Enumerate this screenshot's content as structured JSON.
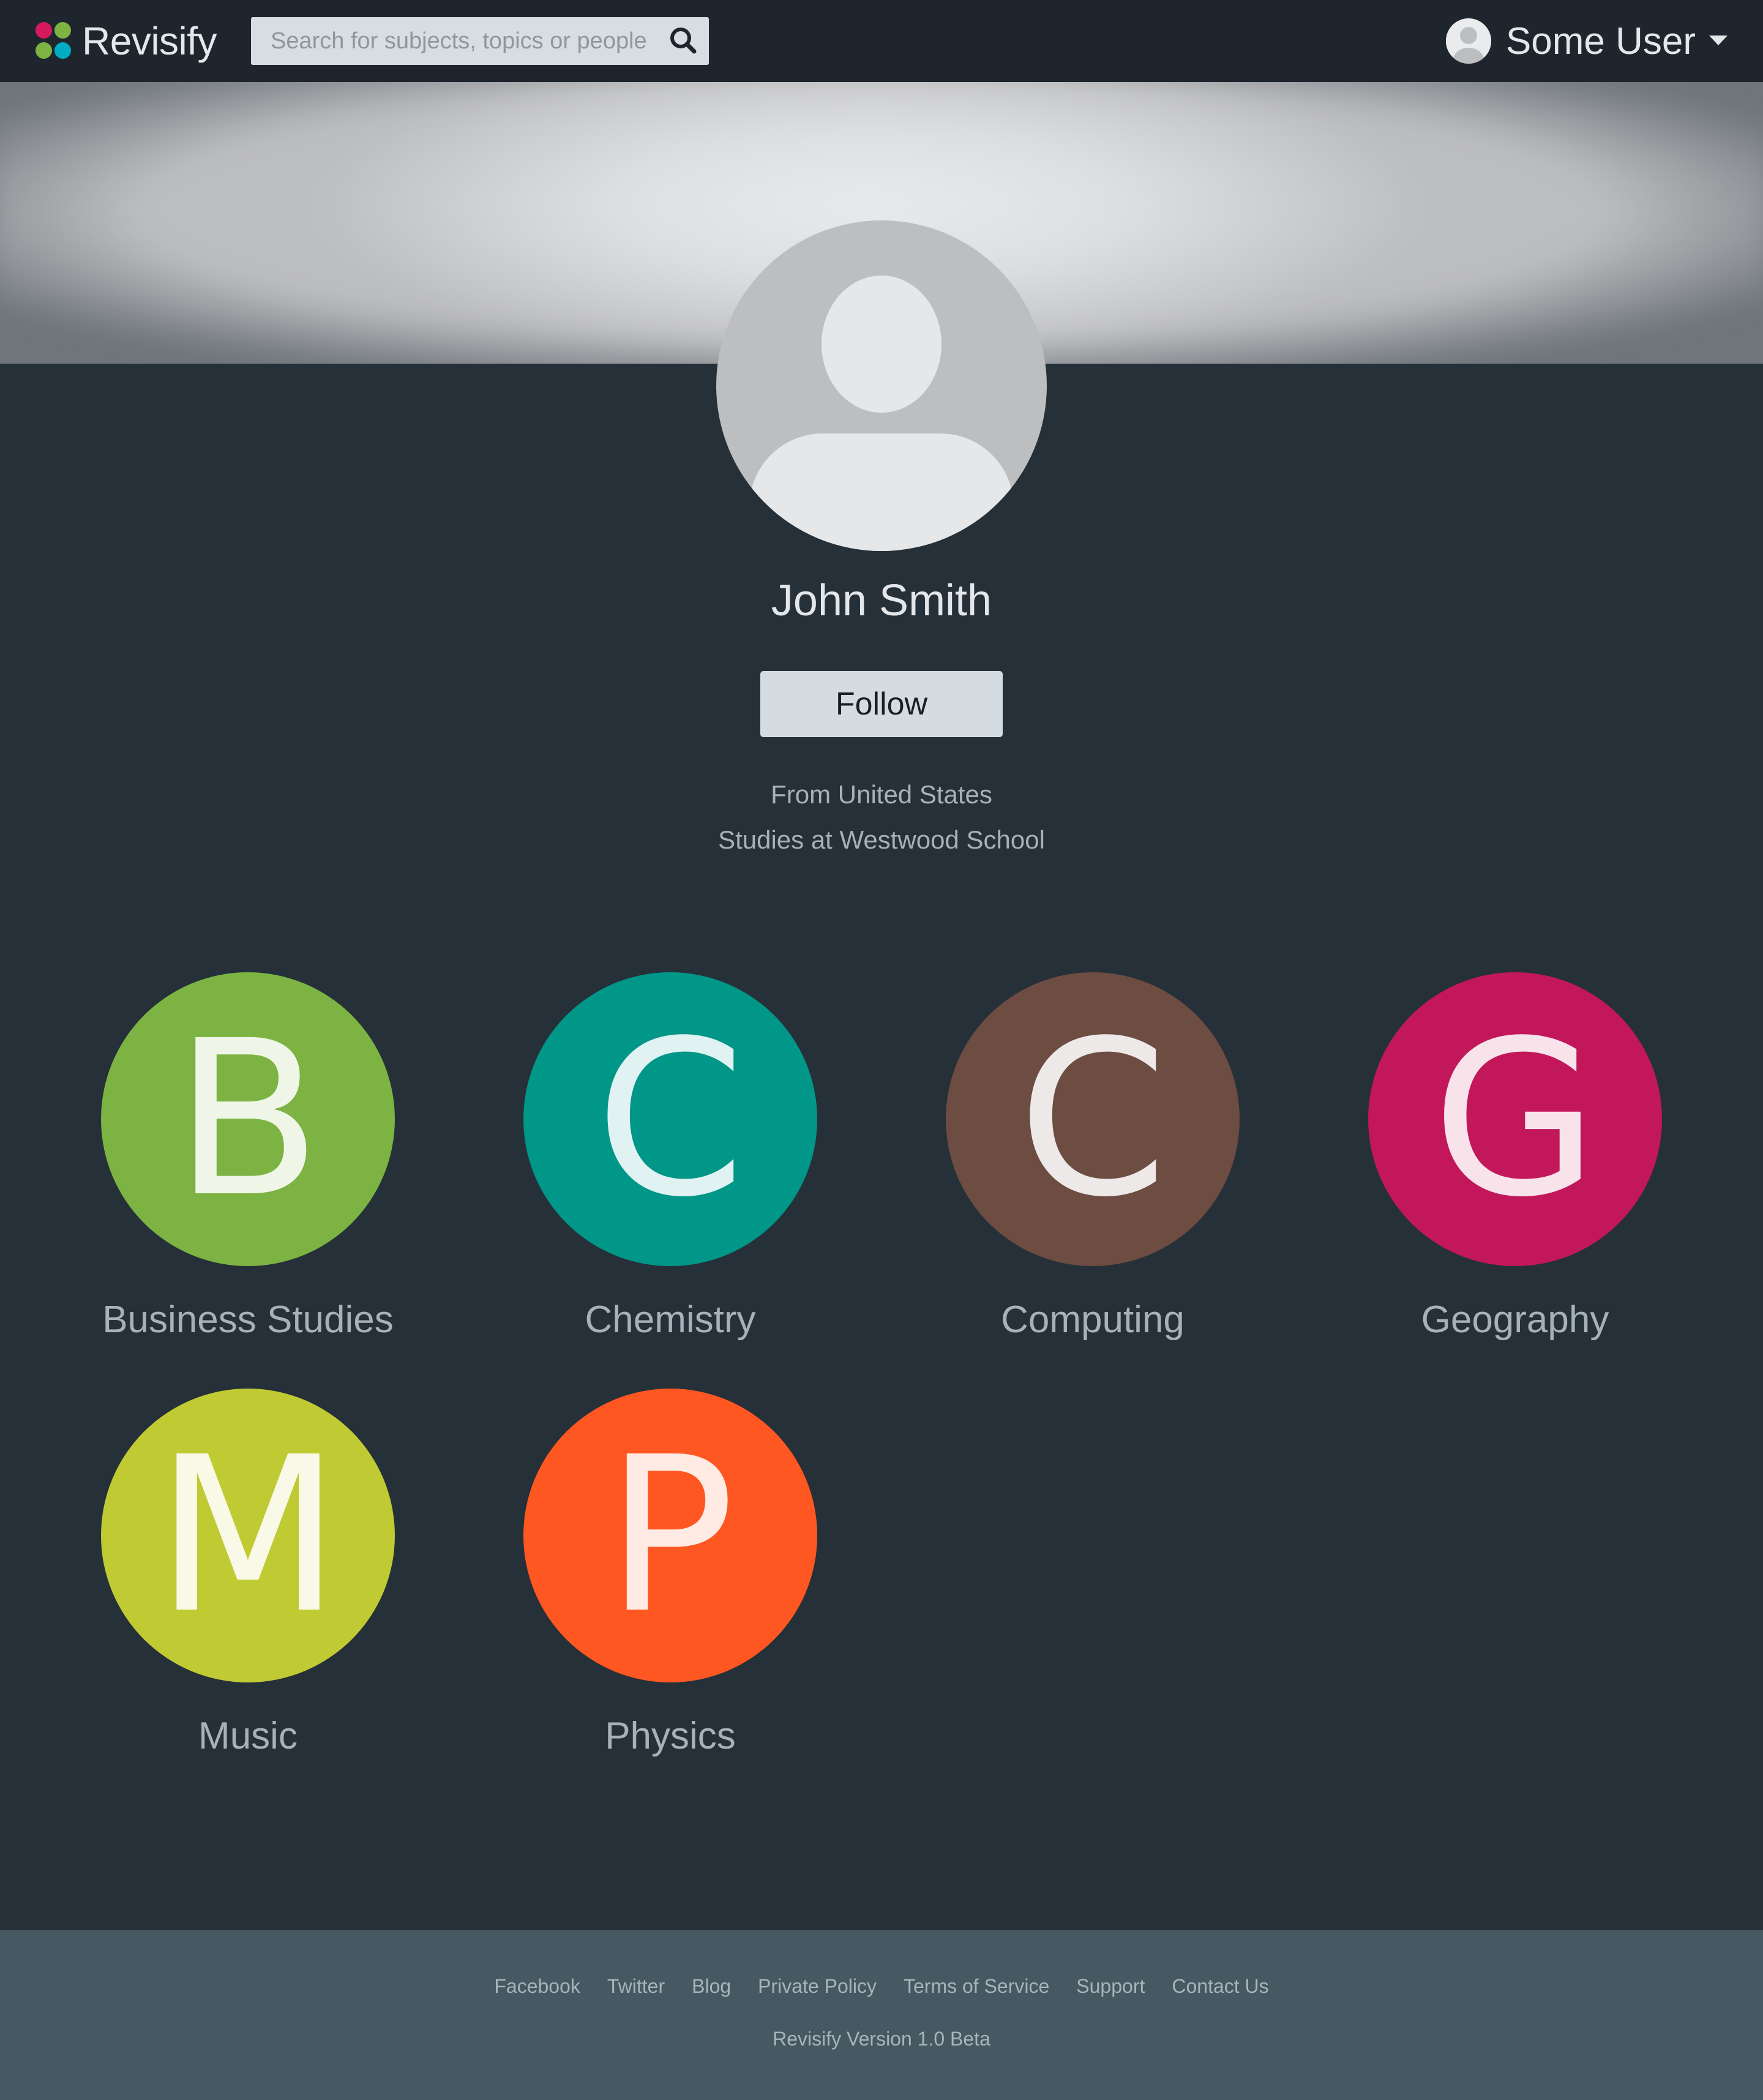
{
  "navbar": {
    "brand_name": "Revisify",
    "logo_colors": [
      "#d6195c",
      "#7cb342",
      "#7cb342",
      "#00acc1"
    ],
    "search_placeholder": "Search for subjects, topics or people",
    "user_name": "Some User"
  },
  "profile": {
    "name": "John Smith",
    "follow_label": "Follow",
    "location": "From United States",
    "school": "Studies at Westwood School"
  },
  "subjects": [
    {
      "letter": "B",
      "label": "Business Studies",
      "color": "#7cb342"
    },
    {
      "letter": "C",
      "label": "Chemistry",
      "color": "#009688"
    },
    {
      "letter": "C",
      "label": "Computing",
      "color": "#6d4c41"
    },
    {
      "letter": "G",
      "label": "Geography",
      "color": "#c2185b"
    },
    {
      "letter": "M",
      "label": "Music",
      "color": "#c0ca33"
    },
    {
      "letter": "P",
      "label": "Physics",
      "color": "#ff5722"
    }
  ],
  "footer": {
    "links": [
      "Facebook",
      "Twitter",
      "Blog",
      "Private Policy",
      "Terms of Service",
      "Support",
      "Contact Us"
    ],
    "version": "Revisify Version 1.0 Beta"
  }
}
